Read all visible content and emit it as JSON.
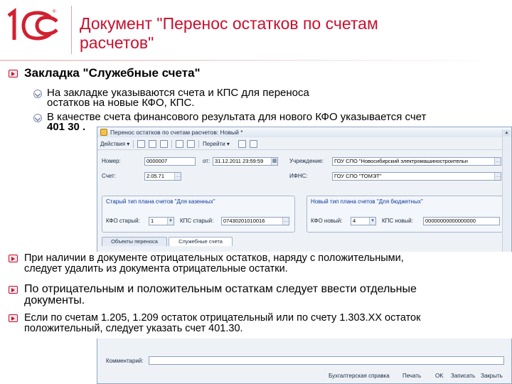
{
  "slide": {
    "logo_text": "1С",
    "title": "Документ \"Перенос остатков по счетам расчетов\"",
    "bullets": [
      {
        "text": "Закладка \"Служебные счета\""
      }
    ],
    "sub_bullets": [
      {
        "line1": "На закладке указываются счета и КПС для переноса",
        "line2": "остатков на новые КФО, КПС."
      },
      {
        "line1": "В качестве счета финансового результата для нового КФО указывается счет",
        "line2": "401 30 ."
      }
    ],
    "bottom_bullets": [
      {
        "line1": "При наличии в документе отрицательных остатков, наряду с положительными,",
        "line2": "следует удалить из документа отрицательные остатки."
      },
      {
        "line1": "По отрицательным и положительным остаткам следует ввести отдельные",
        "line2": "документы."
      },
      {
        "line1": "Если по счетам 1.205, 1.209 остаток отрицательный или по счету 1.303.ХХ остаток",
        "line2": "положительный, следует указать счет 401.30."
      }
    ],
    "colors": {
      "accent": "#c8102e",
      "window_border": "#8fa5c4",
      "group_title": "#0e3aa0"
    }
  },
  "window": {
    "title": "Перенос остатков по счетам расчетов: Новый *",
    "toolbar": {
      "actions_label": "Действия",
      "go_label": "Перейти"
    },
    "fields": {
      "number_label": "Номер:",
      "number_value": "0000007",
      "date_label": "от:",
      "date_value": "31.12.2011 23:59:59",
      "institution_label": "Учреждение:",
      "institution_value": "ГОУ СПО \"Новосибирский электромашиностроительн",
      "account_label": "Счет:",
      "account_value": "2.05.71",
      "inn_label": "ИФНС:",
      "inn_value": "ГОУ СПО \"ТОМЭТ\""
    },
    "old_group": {
      "title": "Старый тип плана счетов \"Для казенных\"",
      "kfo_label": "КФО старый:",
      "kfo_value": "1",
      "kps_label": "КПС старый:",
      "kps_value": "07430201010016"
    },
    "new_group": {
      "title": "Новый тип плана счетов \"Для бюджетных\"",
      "kfo_label": "КФО новый:",
      "kfo_value": "4",
      "kps_label": "КПС новый:",
      "kps_value": "00000000000000000"
    },
    "tabs": [
      {
        "label": "Объекты переноса"
      },
      {
        "label": "Служебные счета"
      }
    ],
    "comment_label": "Комментарий:",
    "bottom_buttons": {
      "journal": "Бухгалтерская справка",
      "print": "Печать",
      "ok": "OK",
      "write": "Записать",
      "close": "Закрыть"
    }
  }
}
